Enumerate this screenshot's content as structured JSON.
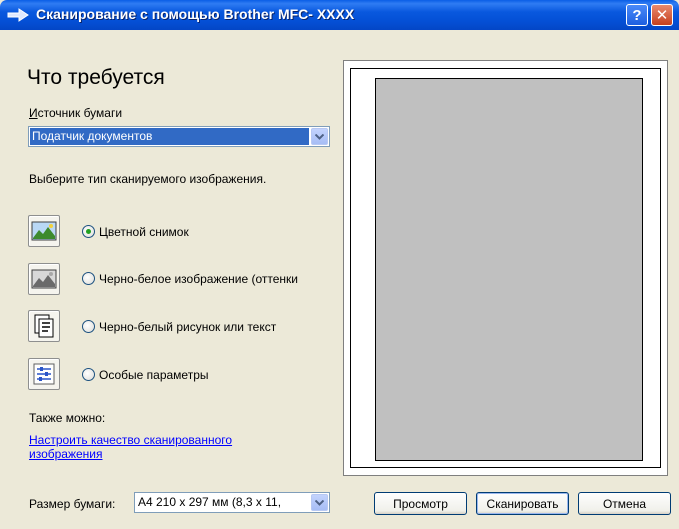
{
  "window": {
    "title": "Сканирование с помощью Brother MFC- XXXX",
    "help_label": "?",
    "close_label": "✕"
  },
  "left": {
    "heading": "Что требуется",
    "paper_source_label": "Источник бумаги",
    "paper_source_value": "Податчик документов",
    "scan_type_prompt": "Выберите тип сканируемого изображения.",
    "options": [
      {
        "label": "Цветной снимок",
        "selected": true,
        "icon": "color-photo-icon"
      },
      {
        "label": "Черно-белое изображение (оттенки",
        "selected": false,
        "icon": "grayscale-photo-icon"
      },
      {
        "label": "Черно-белый рисунок или текст",
        "selected": false,
        "icon": "black-white-text-icon"
      },
      {
        "label": "Особые параметры",
        "selected": false,
        "icon": "custom-settings-icon"
      }
    ],
    "also_label": "Также можно:",
    "adjust_link_line1": "Настроить качество сканированного",
    "adjust_link_line2": "изображения",
    "paper_size_label": "Размер бумаги:",
    "paper_size_value": "A4 210 x 297 мм (8,3 x 11,"
  },
  "buttons": {
    "preview": "Просмотр",
    "scan": "Сканировать",
    "cancel": "Отмена"
  }
}
